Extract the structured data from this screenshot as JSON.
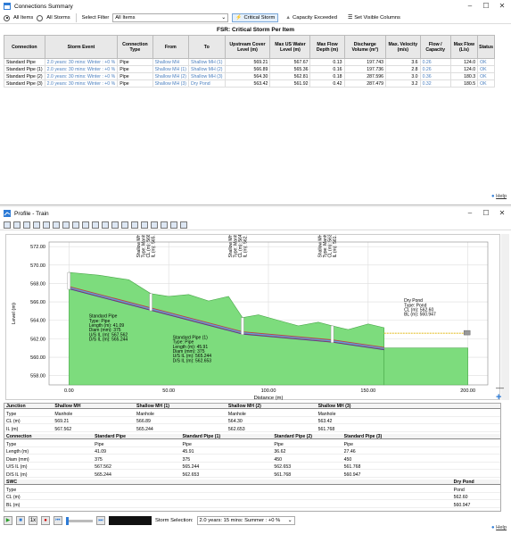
{
  "win1": {
    "title": "Connections Summary",
    "radio_all_items": "All Items",
    "radio_all_storms": "All Storms",
    "select_filter_label": "Select Filter",
    "select_filter_value": "All Items",
    "btn_critical": "Critical Storm",
    "btn_capacity": "Capacity Exceeded",
    "btn_columns": "Set Visible Columns",
    "table_title": "FSR: Critical Storm Per Item",
    "headers": [
      "Connection",
      "Storm Event",
      "Connection Type",
      "From",
      "To",
      "Upstream Cover Level (m)",
      "Max US Water Level (m)",
      "Max Flow Depth (m)",
      "Discharge Volume (m³)",
      "Max. Velocity (m/s)",
      "Flow / Capacity",
      "Max Flow (L/s)",
      "Status"
    ],
    "rows": [
      [
        "Standard Pipe",
        "2.0 years: 30 mins: Winter : +0 %",
        "Pipe",
        "Shallow MH",
        "Shallow MH (1)",
        "569.21",
        "567.67",
        "0.13",
        "197.743",
        "3.6",
        "0.26",
        "124.0",
        "OK"
      ],
      [
        "Standard Pipe (1)",
        "2.0 years: 30 mins: Winter : +0 %",
        "Pipe",
        "Shallow MH (1)",
        "Shallow MH (2)",
        "566.89",
        "565.36",
        "0.16",
        "197.736",
        "2.8",
        "0.26",
        "124.0",
        "OK"
      ],
      [
        "Standard Pipe (2)",
        "2.0 years: 30 mins: Winter : +0 %",
        "Pipe",
        "Shallow MH (2)",
        "Shallow MH (3)",
        "564.30",
        "562.81",
        "0.18",
        "287.596",
        "3.0",
        "0.36",
        "180.3",
        "OK"
      ],
      [
        "Standard Pipe (3)",
        "2.0 years: 30 mins: Winter : +0 %",
        "Pipe",
        "Shallow MH (3)",
        "Dry Pond",
        "563.42",
        "561.92",
        "0.42",
        "287.479",
        "3.2",
        "0.32",
        "180.5",
        "OK"
      ]
    ],
    "help": "Help"
  },
  "win2": {
    "title": "Profile - Train",
    "help": "Help",
    "storm_selection_label": "Storm Selection:",
    "storm_selection_value": "2.0 years: 15 mins: Summer : +0 %",
    "plus": "+",
    "minus": "—"
  },
  "chart_data": {
    "type": "area",
    "title": "",
    "xlabel": "Distance (m)",
    "ylabel": "Level (m)",
    "xlim": [
      -10,
      210
    ],
    "ylim": [
      557,
      572.5
    ],
    "x_ticks": [
      "0.00",
      "50.00",
      "100.00",
      "150.00",
      "200.00"
    ],
    "x_tick_values": [
      0,
      50,
      100,
      150,
      200
    ],
    "y_ticks": [
      "558.00",
      "560.00",
      "562.00",
      "564.00",
      "566.00",
      "568.00",
      "570.00",
      "572.00"
    ],
    "y_tick_values": [
      558,
      560,
      562,
      564,
      566,
      568,
      570,
      572
    ],
    "ground": {
      "x": [
        0,
        15,
        30,
        41,
        50,
        60,
        70,
        80,
        87,
        95,
        105,
        115,
        125,
        132,
        140,
        150,
        158
      ],
      "y": [
        569.2,
        568.9,
        568.4,
        566.9,
        566.6,
        566.8,
        566.1,
        566.6,
        564.3,
        564.6,
        564.0,
        563.4,
        563.8,
        563.4,
        563.0,
        563.6,
        563.2
      ]
    },
    "pipe": {
      "x": [
        0,
        41,
        87,
        132,
        158
      ],
      "y": [
        567.56,
        565.24,
        562.65,
        561.77,
        560.95
      ]
    },
    "pond_ground": {
      "x": [
        158,
        200
      ],
      "y": [
        561.0,
        561.0
      ]
    },
    "manholes": [
      {
        "x": 0,
        "label": ""
      },
      {
        "x": 41,
        "label": "Shallow MH (1)\nType: Manhole\nCL (m): 566.89\nIL (m): 565.244"
      },
      {
        "x": 87,
        "label": "Shallow MH (2)\nType: Manhole\nCL (m): 564.30\nIL (m): 562.653"
      },
      {
        "x": 132,
        "label": "Shallow MH (3)\nType: Manhole\nCL (m): 563.42\nIL (m): 561.768"
      }
    ],
    "annotations": [
      {
        "x": 10,
        "y": 564.3,
        "lines": [
          "Standard Pipe",
          "Type: Pipe",
          "Length (m): 41.09",
          "Diam (mm): 375",
          "U/S IL (m): 567.562",
          "D/S IL (m): 565.244"
        ]
      },
      {
        "x": 52,
        "y": 562.0,
        "lines": [
          "Standard Pipe (1)",
          "Type: Pipe",
          "Length (m): 45.91",
          "Diam (mm): 375",
          "U/S IL (m): 565.244",
          "D/S IL (m): 562.653"
        ]
      },
      {
        "x": 168,
        "y": 566.0,
        "lines": [
          "Dry Pond",
          "Type: Pond",
          "CL (m): 562.60",
          "BL (m): 560.947"
        ]
      }
    ]
  },
  "grid": {
    "rows": [
      {
        "label": "Junction",
        "bold": true,
        "cells": [
          [
            "Shallow MH",
            0
          ],
          [
            "Shallow MH (1)",
            41
          ],
          [
            "Shallow MH (2)",
            87
          ],
          [
            "Shallow MH (3)",
            132
          ]
        ]
      },
      {
        "label": "Type",
        "cells": [
          [
            "Manhole",
            0
          ],
          [
            "Manhole",
            41
          ],
          [
            "Manhole",
            87
          ],
          [
            "Manhole",
            132
          ]
        ]
      },
      {
        "label": "CL (m)",
        "cells": [
          [
            "569.21",
            0
          ],
          [
            "566.89",
            41
          ],
          [
            "564.30",
            87
          ],
          [
            "563.42",
            132
          ]
        ]
      },
      {
        "label": "IL (m)",
        "cells": [
          [
            "567.562",
            0
          ],
          [
            "565.244",
            41
          ],
          [
            "562.653",
            87
          ],
          [
            "561.768",
            132
          ]
        ]
      },
      {
        "label": "Connection",
        "bold": true,
        "cells": [
          [
            "Standard Pipe",
            20
          ],
          [
            "Standard Pipe (1)",
            64
          ],
          [
            "Standard Pipe (2)",
            110
          ],
          [
            "Standard Pipe (3)",
            145
          ]
        ]
      },
      {
        "label": "Type",
        "cells": [
          [
            "Pipe",
            20
          ],
          [
            "Pipe",
            64
          ],
          [
            "Pipe",
            110
          ],
          [
            "Pipe",
            145
          ]
        ]
      },
      {
        "label": "Length (m)",
        "cells": [
          [
            "41.09",
            20
          ],
          [
            "45.91",
            64
          ],
          [
            "36.62",
            110
          ],
          [
            "27.46",
            145
          ]
        ]
      },
      {
        "label": "Diam (mm)",
        "cells": [
          [
            "375",
            20
          ],
          [
            "375",
            64
          ],
          [
            "450",
            110
          ],
          [
            "450",
            145
          ]
        ]
      },
      {
        "label": "U/S IL (m)",
        "cells": [
          [
            "567.562",
            20
          ],
          [
            "565.244",
            64
          ],
          [
            "562.653",
            110
          ],
          [
            "561.768",
            145
          ]
        ]
      },
      {
        "label": "D/S IL (m)",
        "cells": [
          [
            "565.244",
            20
          ],
          [
            "562.653",
            64
          ],
          [
            "561.768",
            110
          ],
          [
            "560.947",
            145
          ]
        ]
      },
      {
        "label": "SWC",
        "bold": true,
        "cells": [
          [
            "Dry Pond",
            200
          ]
        ]
      },
      {
        "label": "Type",
        "cells": [
          [
            "Pond",
            200
          ]
        ]
      },
      {
        "label": "CL (m)",
        "cells": [
          [
            "562.60",
            200
          ]
        ]
      },
      {
        "label": "BL (m)",
        "cells": [
          [
            "560.947",
            200
          ]
        ]
      }
    ]
  }
}
